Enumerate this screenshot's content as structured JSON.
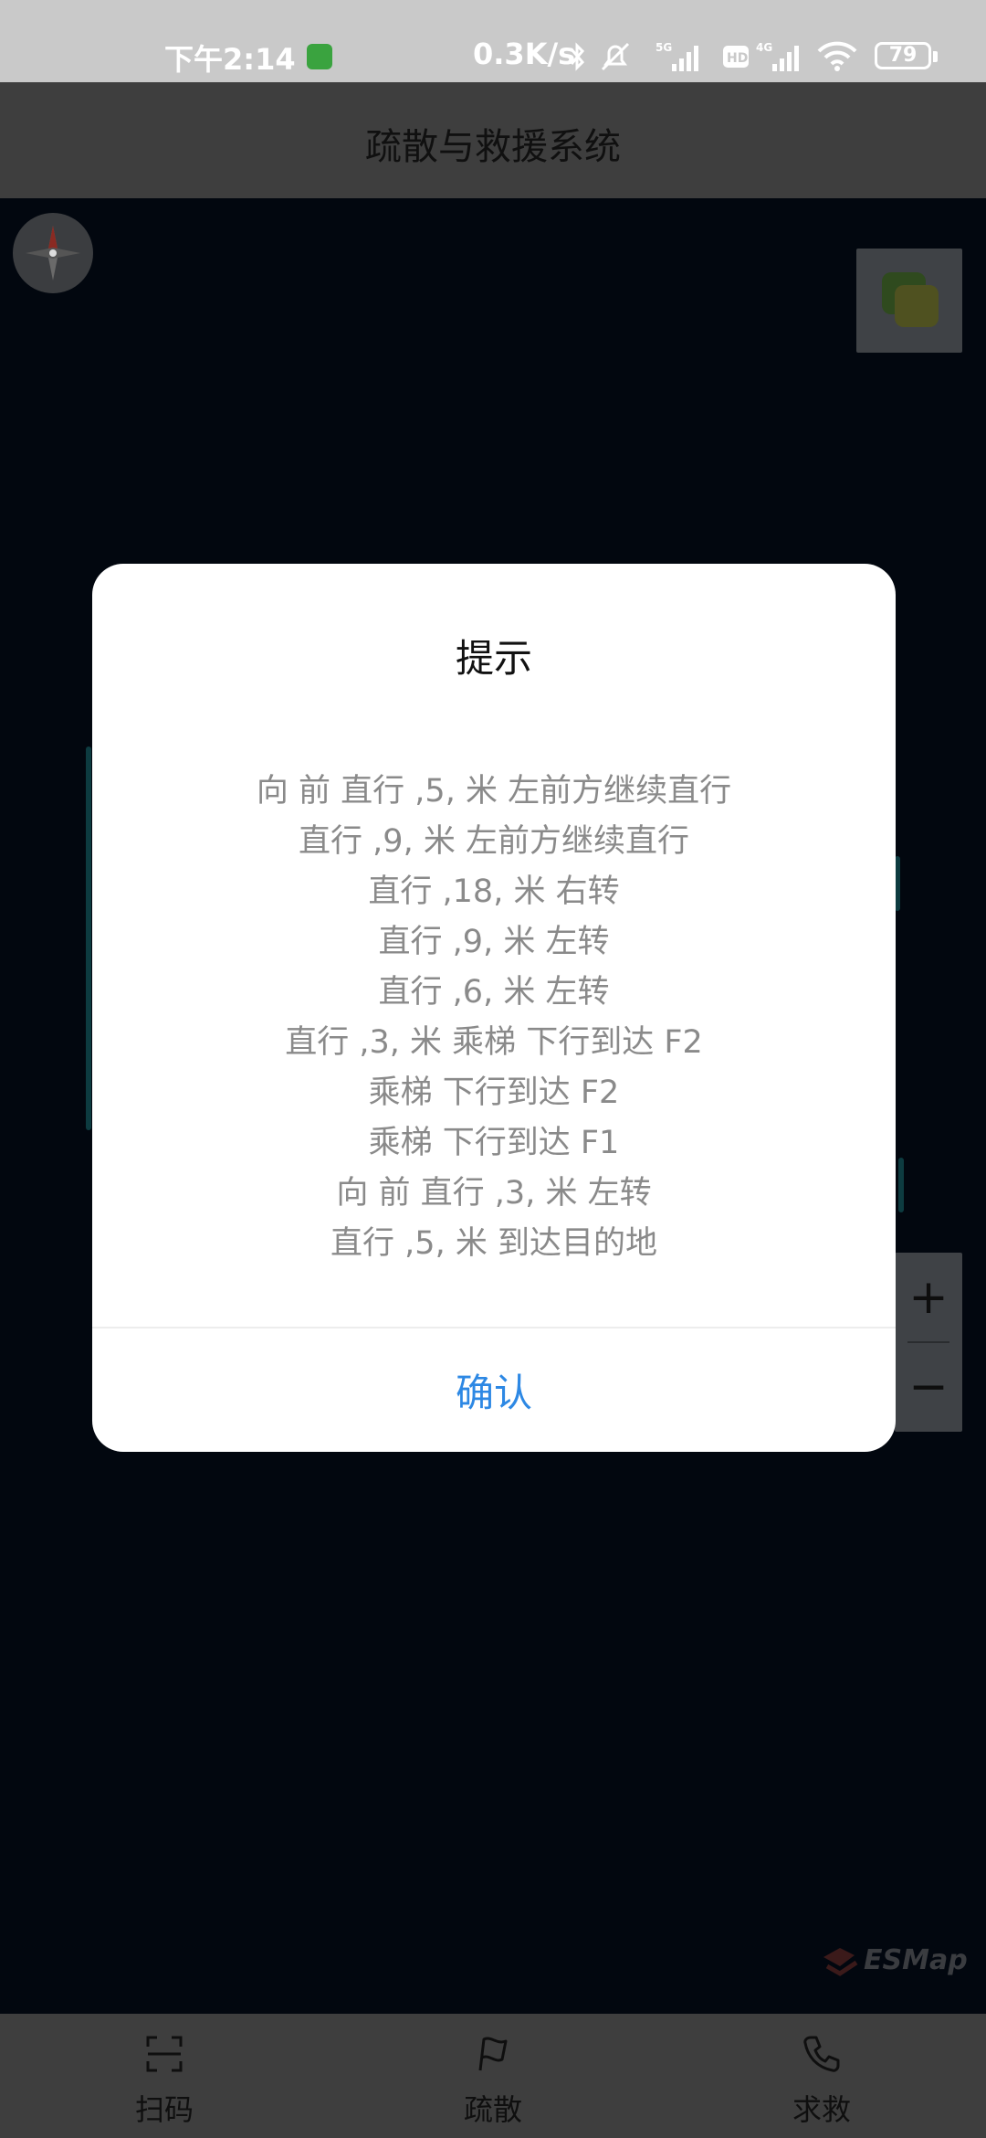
{
  "status_bar": {
    "time": "下午2:14",
    "network_speed": "0.3K/s",
    "battery": "79",
    "icons": [
      "app-notification-icon",
      "bluetooth-icon",
      "silent-icon",
      "5g-signal-icon",
      "hd-icon",
      "4g-signal-icon",
      "wifi-icon",
      "battery-icon"
    ]
  },
  "header": {
    "title": "疏散与救援系统"
  },
  "map": {
    "logo": "ESMap",
    "zoom_in": "+",
    "zoom_out": "−"
  },
  "dialog": {
    "title": "提示",
    "lines": [
      "向 前 直行 ,5, 米 左前方继续直行",
      "直行 ,9, 米 左前方继续直行",
      "直行 ,18, 米 右转",
      "直行 ,9, 米 左转",
      "直行 ,6, 米 左转",
      "直行 ,3, 米 乘梯 下行到达 F2",
      "乘梯 下行到达 F2",
      "乘梯 下行到达 F1",
      "向 前 直行 ,3, 米 左转",
      "直行 ,5, 米 到达目的地"
    ],
    "confirm_label": "确认"
  },
  "bottom_nav": {
    "items": [
      {
        "label": "扫码",
        "icon": "scan-icon"
      },
      {
        "label": "疏散",
        "icon": "flag-icon"
      },
      {
        "label": "求救",
        "icon": "phone-icon"
      }
    ]
  },
  "colors": {
    "accent": "#2d88e4",
    "map_background": "#02070f"
  }
}
